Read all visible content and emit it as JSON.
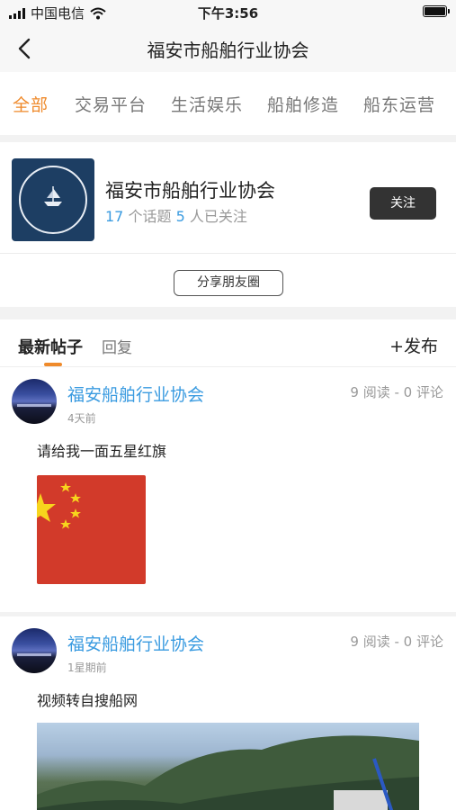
{
  "status": {
    "carrier": "中国电信",
    "time": "下午3:56"
  },
  "nav": {
    "title": "福安市船舶行业协会"
  },
  "tabs": [
    {
      "label": "全部",
      "active": true
    },
    {
      "label": "交易平台",
      "active": false
    },
    {
      "label": "生活娱乐",
      "active": false
    },
    {
      "label": "船舶修造",
      "active": false
    },
    {
      "label": "船东运营",
      "active": false
    }
  ],
  "org": {
    "name": "福安市船舶行业协会",
    "topics": "17",
    "topics_suffix": "个话题",
    "followers": "5",
    "followers_suffix": "人已关注",
    "follow_label": "关注",
    "share_label": "分享朋友圈"
  },
  "posts_header": {
    "tab_latest": "最新帖子",
    "tab_reply": "回复",
    "publish": "+发布"
  },
  "posts": [
    {
      "author": "福安船舶行业协会",
      "time": "4天前",
      "meta": "9 阅读 - 0 评论",
      "text": "请给我一面五星红旗",
      "image": "china-flag"
    },
    {
      "author": "福安船舶行业协会",
      "time": "1星期前",
      "meta": "9 阅读 - 0 评论",
      "text": "视频转自搜船网",
      "image": "harbor-landscape"
    }
  ],
  "colors": {
    "accent": "#ef8a2b",
    "link": "#3a9be0",
    "flag_red": "#d23a2a",
    "flag_star": "#f7d51d"
  }
}
